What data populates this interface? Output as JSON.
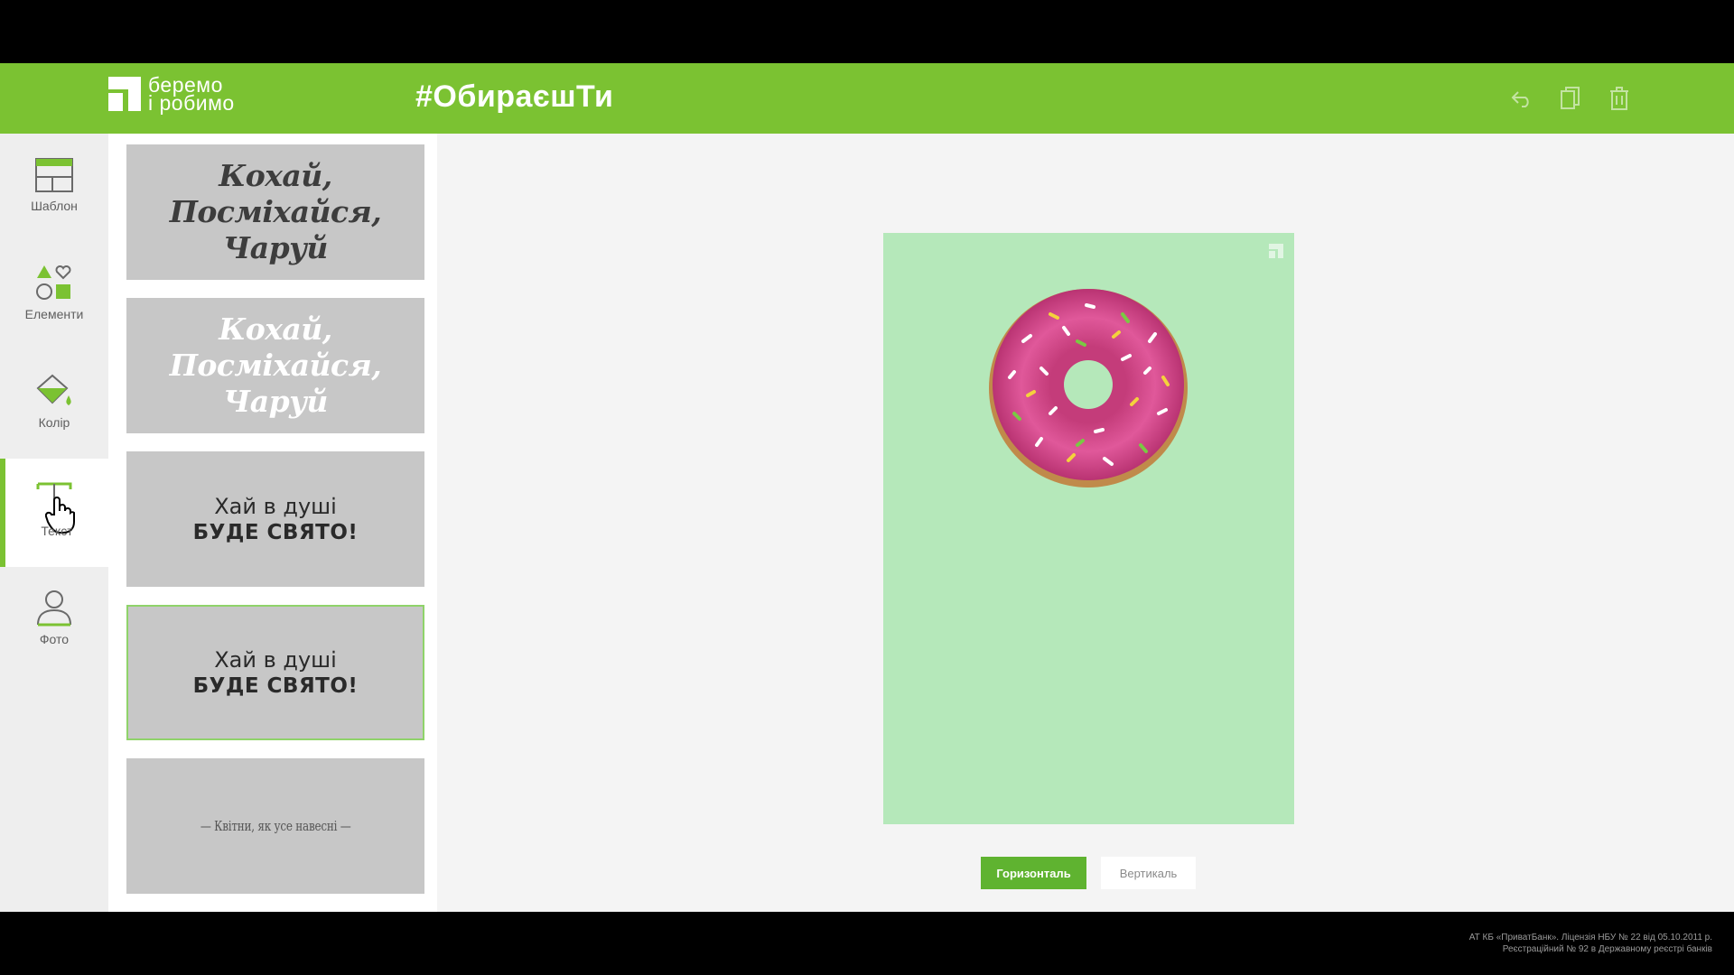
{
  "header": {
    "logo_line1": "беремо",
    "logo_line2": "і робимо",
    "hashtag": "#ОбираєшТи",
    "actions": [
      "undo-icon",
      "copy-icon",
      "trash-icon"
    ]
  },
  "sidebar": {
    "items": [
      {
        "label": "Шаблон",
        "icon": "template-icon"
      },
      {
        "label": "Елементи",
        "icon": "shapes-icon"
      },
      {
        "label": "Колір",
        "icon": "paint-bucket-icon"
      },
      {
        "label": "Текст",
        "icon": "text-icon",
        "active": true
      },
      {
        "label": "Фото",
        "icon": "user-icon"
      }
    ]
  },
  "panel": {
    "thumbs": [
      {
        "lines": [
          "Кохай,",
          "Посміхайся,",
          "Чаруй"
        ]
      },
      {
        "lines": [
          "Кохай,",
          "Посміхайся,",
          "Чаруй"
        ]
      },
      {
        "line1": "Хай в душі",
        "line2": "БУДЕ СВЯТО!"
      },
      {
        "line1": "Хай в душі",
        "line2": "БУДЕ СВЯТО!"
      },
      {
        "quote": "— Квітни, як усе навесні —"
      }
    ]
  },
  "canvas": {
    "background_color": "#b5e8ba",
    "orientation_buttons": {
      "horizontal": "Горизонталь",
      "vertical": "Вертикаль"
    }
  },
  "footer": {
    "legal_line1": "АТ КБ «ПриватБанк». Ліцензія НБУ № 22 від 05.10.2011 р.",
    "legal_line2": "Реєстраційний № 92 в Державному реєстрі банків"
  },
  "colors": {
    "brand_green": "#7bc232",
    "button_green": "#5fb330"
  }
}
